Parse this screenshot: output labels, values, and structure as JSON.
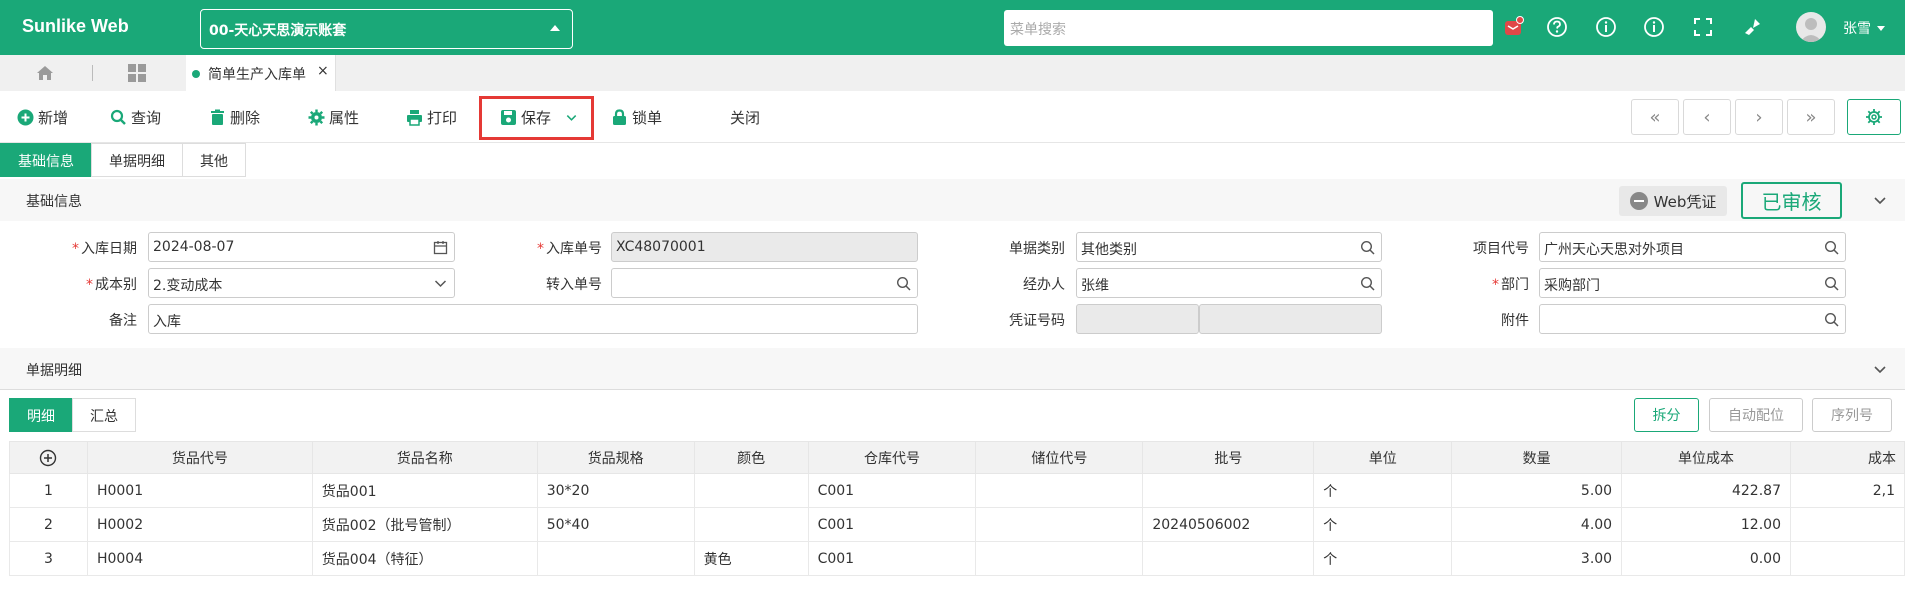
{
  "header": {
    "brand": "Sunlike Web",
    "account": "00-天心天思演示账套",
    "search_placeholder": "菜单搜索",
    "username": "张雪",
    "icons": [
      "notification-icon",
      "help-icon",
      "info-icon",
      "about-icon",
      "fullscreen-icon",
      "clean-icon"
    ]
  },
  "tabs": {
    "active_label": "简单生产入库单",
    "close": "×"
  },
  "toolbar": {
    "new": "新增",
    "query": "查询",
    "delete": "删除",
    "properties": "属性",
    "print": "打印",
    "save": "保存",
    "lock": "锁单",
    "close": "关闭",
    "nav": [
      "«",
      "‹",
      "›",
      "»"
    ]
  },
  "subtabs": [
    "基础信息",
    "单据明细",
    "其他"
  ],
  "basic_section": {
    "title": "基础信息",
    "voucher_label": "Web凭证",
    "status": "已审核"
  },
  "form": {
    "in_date_label": "入库日期",
    "in_date": "2024-08-07",
    "in_no_label": "入库单号",
    "in_no": "XC48070001",
    "doc_type_label": "单据类别",
    "doc_type": "其他类别",
    "project_label": "项目代号",
    "project": "广州天心天思对外项目",
    "cost_type_label": "成本别",
    "cost_type": "2.变动成本",
    "transfer_no_label": "转入单号",
    "transfer_no": "",
    "handler_label": "经办人",
    "handler": "张维",
    "dept_label": "部门",
    "dept": "采购部门",
    "remark_label": "备注",
    "remark": "入库",
    "voucher_no_label": "凭证号码",
    "attachment_label": "附件"
  },
  "detail_section": {
    "title": "单据明细",
    "tabs": [
      "明细",
      "汇总"
    ],
    "buttons": [
      "拆分",
      "自动配位",
      "序列号"
    ]
  },
  "grid": {
    "headers": [
      "货品代号",
      "货品名称",
      "货品规格",
      "颜色",
      "仓库代号",
      "储位代号",
      "批号",
      "单位",
      "数量",
      "单位成本",
      "成本"
    ],
    "rows": [
      {
        "no": "1",
        "code": "H0001",
        "name": "货品001",
        "spec": "30*20",
        "color": "",
        "wh": "C001",
        "loc": "",
        "batch": "",
        "unit": "个",
        "qty": "5.00",
        "unit_cost": "422.87",
        "cost": "2,1"
      },
      {
        "no": "2",
        "code": "H0002",
        "name": "货品002（批号管制）",
        "spec": "50*40",
        "color": "",
        "wh": "C001",
        "loc": "",
        "batch": "20240506002",
        "unit": "个",
        "qty": "4.00",
        "unit_cost": "12.00",
        "cost": ""
      },
      {
        "no": "3",
        "code": "H0004",
        "name": "货品004（特征）",
        "spec": "",
        "color": "黄色",
        "wh": "C001",
        "loc": "",
        "batch": "",
        "unit": "个",
        "qty": "3.00",
        "unit_cost": "0.00",
        "cost": ""
      }
    ]
  },
  "colors": {
    "brand": "#1aa878",
    "highlight": "#e53935"
  }
}
